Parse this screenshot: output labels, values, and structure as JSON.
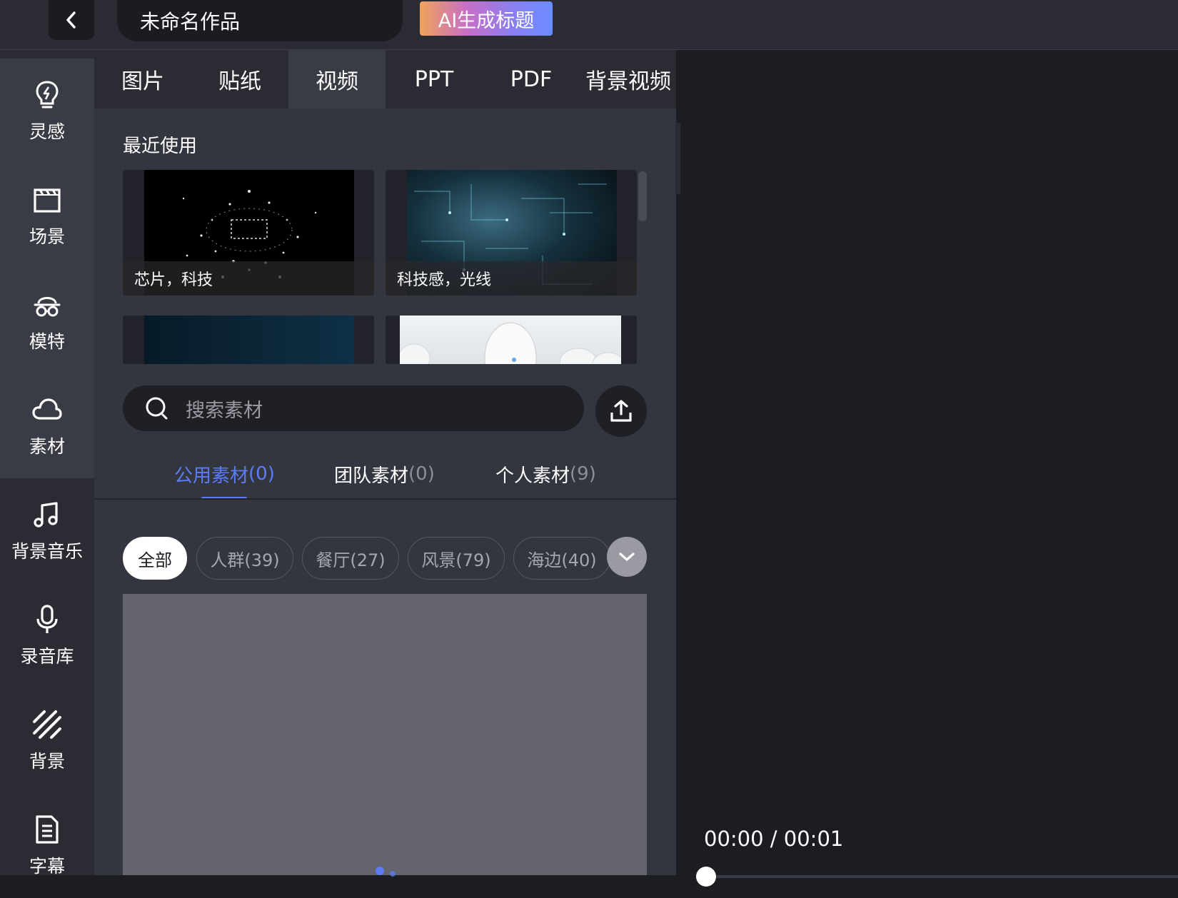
{
  "header": {
    "back_icon": "chevron-left-icon",
    "project_title": "未命名作品",
    "ai_title_button": "AI生成标题",
    "ai_button_gradient": [
      "#f0a35a",
      "#c86fc6",
      "#8a7ef0",
      "#6a8cff"
    ]
  },
  "sidebar": {
    "items": [
      {
        "label": "灵感",
        "icon": "lightbulb-icon",
        "active": true
      },
      {
        "label": "场景",
        "icon": "clapperboard-icon",
        "active": true
      },
      {
        "label": "模特",
        "icon": "model-icon",
        "active": true
      },
      {
        "label": "素材",
        "icon": "cloud-icon",
        "active": true
      },
      {
        "label": "背景音乐",
        "icon": "music-note-icon",
        "active": false
      },
      {
        "label": "录音库",
        "icon": "microphone-icon",
        "active": false
      },
      {
        "label": "背景",
        "icon": "background-stripes-icon",
        "active": false
      },
      {
        "label": "字幕",
        "icon": "document-icon",
        "active": false
      }
    ]
  },
  "panel": {
    "tabs": [
      {
        "label": "图片",
        "active": false
      },
      {
        "label": "贴纸",
        "active": false
      },
      {
        "label": "视频",
        "active": true
      },
      {
        "label": "PPT",
        "active": false
      },
      {
        "label": "PDF",
        "active": false
      },
      {
        "label": "背景视频",
        "active": false
      }
    ],
    "recent_title": "最近使用",
    "recent_items": [
      {
        "caption": "芯片，科技"
      },
      {
        "caption": "科技感，光线"
      },
      {
        "caption": ""
      },
      {
        "caption": ""
      }
    ],
    "search": {
      "placeholder": "搜索素材",
      "icon": "search-icon",
      "upload_icon": "upload-icon"
    },
    "source_tabs": [
      {
        "label": "公用素材",
        "count": "(0)",
        "active": true
      },
      {
        "label": "团队素材",
        "count": "(0)",
        "active": false
      },
      {
        "label": "个人素材",
        "count": "(9)",
        "active": false
      }
    ],
    "categories": [
      {
        "label": "全部",
        "active": true
      },
      {
        "label": "人群(39)",
        "active": false
      },
      {
        "label": "餐厅(27)",
        "active": false
      },
      {
        "label": "风景(79)",
        "active": false
      },
      {
        "label": "海边(40)",
        "active": false
      }
    ],
    "more_icon": "chevron-down-icon",
    "accent_color": "#5b7cf5"
  },
  "preview": {
    "timecode": "00:00 / 00:01",
    "collapse_icon": "chevron-left-icon"
  }
}
